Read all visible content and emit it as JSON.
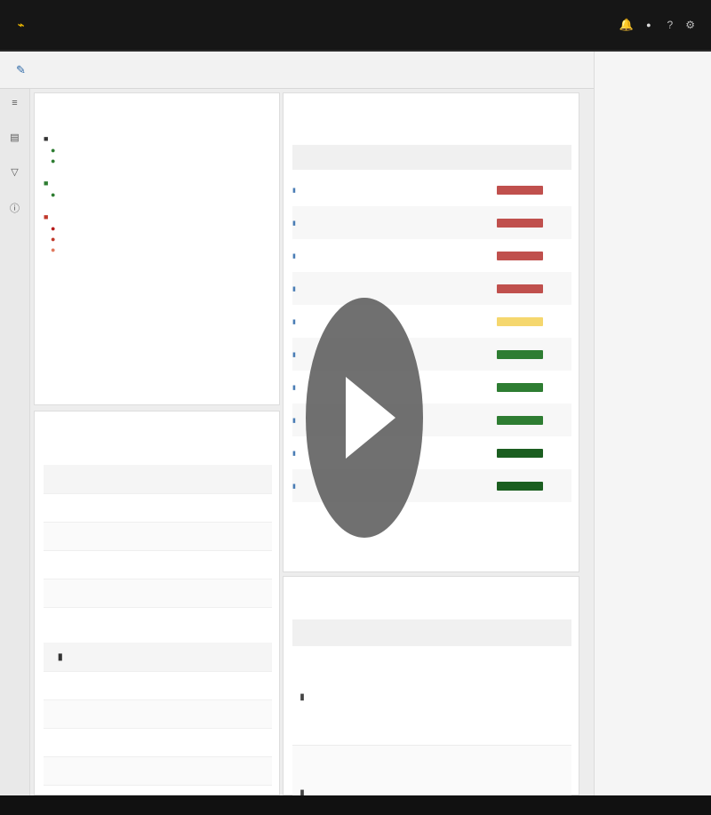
{
  "nav": {
    "logo": "",
    "items": [
      "",
      "",
      "",
      ""
    ],
    "user": "",
    "icons": [
      "bell-icon",
      "user-icon",
      "help-icon",
      "settings-icon"
    ]
  },
  "page": {
    "title": ""
  },
  "right_panel": {
    "title": "",
    "subtitle": ""
  },
  "panels": {
    "notification_tree": {
      "title": "",
      "link": "",
      "groups": [
        {
          "label": "",
          "color": "#333333",
          "items": [
            {
              "label": "",
              "color": "#2e7d32"
            },
            {
              "label": "",
              "color": "#2e7d32"
            }
          ]
        },
        {
          "label": "",
          "color": "#2e7d32",
          "items": [
            {
              "label": "",
              "color": "#2e7d32"
            }
          ]
        },
        {
          "label": "",
          "color": "#c0392b",
          "items": [
            {
              "label": "",
              "color": "#b71c1c"
            },
            {
              "label": "",
              "color": "#c0392b"
            },
            {
              "label": "",
              "color": "#e07a5f"
            }
          ]
        }
      ]
    },
    "details": {
      "title": "",
      "link": "",
      "section_1": "",
      "rows_1": [
        {
          "key": "",
          "value": ""
        },
        {
          "key": "",
          "value": ""
        },
        {
          "key": "",
          "value": ""
        },
        {
          "key": "",
          "value": ""
        },
        {
          "key": "",
          "value": ""
        }
      ],
      "section_2": "",
      "rows_2": [
        {
          "key": "",
          "value": ""
        },
        {
          "key": "",
          "value": ""
        },
        {
          "key": "",
          "value": ""
        },
        {
          "key": "",
          "value": ""
        },
        {
          "key": "",
          "value": ""
        }
      ]
    },
    "top_health": {
      "title": "",
      "link": "",
      "headers": [
        "",
        "",
        ""
      ],
      "rows": [
        {
          "name": "",
          "type": "",
          "score": "",
          "color": "#c0504d"
        },
        {
          "name": "",
          "type": "",
          "score": "",
          "color": "#c0504d"
        },
        {
          "name": "",
          "type": "",
          "score": "",
          "color": "#c0504d"
        },
        {
          "name": "",
          "type": "",
          "score": "",
          "color": "#c0504d"
        },
        {
          "name": "",
          "type": "",
          "score": "",
          "color": "#f5d76e"
        },
        {
          "name": "",
          "type": "",
          "score": "",
          "color": "#2e7d32"
        },
        {
          "name": "",
          "type": "",
          "score": "",
          "color": "#2e7d32"
        },
        {
          "name": "",
          "type": "",
          "score": "",
          "color": "#2e7d32"
        },
        {
          "name": "",
          "type": "",
          "score": "",
          "color": "#1b5e20"
        },
        {
          "name": "",
          "type": "",
          "score": "",
          "color": "#1b5e20"
        }
      ]
    },
    "recent_alerts": {
      "title": "",
      "link": "",
      "headers": [
        "",
        "",
        "",
        "",
        "",
        ""
      ],
      "rows": [
        {
          "name": "",
          "cells": [
            "",
            "",
            "",
            "",
            ""
          ]
        },
        {
          "name": "",
          "cells": [
            "",
            "",
            "",
            "",
            ""
          ]
        }
      ]
    }
  },
  "video": {
    "state": "paused"
  }
}
